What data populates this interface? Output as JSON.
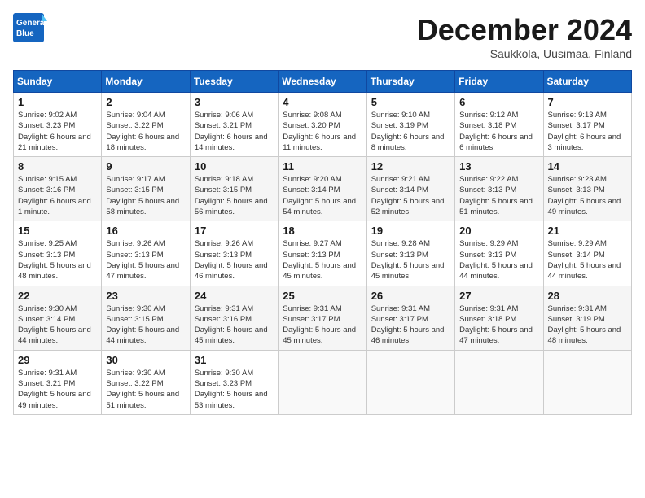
{
  "header": {
    "logo_general": "General",
    "logo_blue": "Blue",
    "month_title": "December 2024",
    "subtitle": "Saukkola, Uusimaa, Finland"
  },
  "days_of_week": [
    "Sunday",
    "Monday",
    "Tuesday",
    "Wednesday",
    "Thursday",
    "Friday",
    "Saturday"
  ],
  "weeks": [
    [
      {
        "day": "1",
        "sunrise": "Sunrise: 9:02 AM",
        "sunset": "Sunset: 3:23 PM",
        "daylight": "Daylight: 6 hours and 21 minutes."
      },
      {
        "day": "2",
        "sunrise": "Sunrise: 9:04 AM",
        "sunset": "Sunset: 3:22 PM",
        "daylight": "Daylight: 6 hours and 18 minutes."
      },
      {
        "day": "3",
        "sunrise": "Sunrise: 9:06 AM",
        "sunset": "Sunset: 3:21 PM",
        "daylight": "Daylight: 6 hours and 14 minutes."
      },
      {
        "day": "4",
        "sunrise": "Sunrise: 9:08 AM",
        "sunset": "Sunset: 3:20 PM",
        "daylight": "Daylight: 6 hours and 11 minutes."
      },
      {
        "day": "5",
        "sunrise": "Sunrise: 9:10 AM",
        "sunset": "Sunset: 3:19 PM",
        "daylight": "Daylight: 6 hours and 8 minutes."
      },
      {
        "day": "6",
        "sunrise": "Sunrise: 9:12 AM",
        "sunset": "Sunset: 3:18 PM",
        "daylight": "Daylight: 6 hours and 6 minutes."
      },
      {
        "day": "7",
        "sunrise": "Sunrise: 9:13 AM",
        "sunset": "Sunset: 3:17 PM",
        "daylight": "Daylight: 6 hours and 3 minutes."
      }
    ],
    [
      {
        "day": "8",
        "sunrise": "Sunrise: 9:15 AM",
        "sunset": "Sunset: 3:16 PM",
        "daylight": "Daylight: 6 hours and 1 minute."
      },
      {
        "day": "9",
        "sunrise": "Sunrise: 9:17 AM",
        "sunset": "Sunset: 3:15 PM",
        "daylight": "Daylight: 5 hours and 58 minutes."
      },
      {
        "day": "10",
        "sunrise": "Sunrise: 9:18 AM",
        "sunset": "Sunset: 3:15 PM",
        "daylight": "Daylight: 5 hours and 56 minutes."
      },
      {
        "day": "11",
        "sunrise": "Sunrise: 9:20 AM",
        "sunset": "Sunset: 3:14 PM",
        "daylight": "Daylight: 5 hours and 54 minutes."
      },
      {
        "day": "12",
        "sunrise": "Sunrise: 9:21 AM",
        "sunset": "Sunset: 3:14 PM",
        "daylight": "Daylight: 5 hours and 52 minutes."
      },
      {
        "day": "13",
        "sunrise": "Sunrise: 9:22 AM",
        "sunset": "Sunset: 3:13 PM",
        "daylight": "Daylight: 5 hours and 51 minutes."
      },
      {
        "day": "14",
        "sunrise": "Sunrise: 9:23 AM",
        "sunset": "Sunset: 3:13 PM",
        "daylight": "Daylight: 5 hours and 49 minutes."
      }
    ],
    [
      {
        "day": "15",
        "sunrise": "Sunrise: 9:25 AM",
        "sunset": "Sunset: 3:13 PM",
        "daylight": "Daylight: 5 hours and 48 minutes."
      },
      {
        "day": "16",
        "sunrise": "Sunrise: 9:26 AM",
        "sunset": "Sunset: 3:13 PM",
        "daylight": "Daylight: 5 hours and 47 minutes."
      },
      {
        "day": "17",
        "sunrise": "Sunrise: 9:26 AM",
        "sunset": "Sunset: 3:13 PM",
        "daylight": "Daylight: 5 hours and 46 minutes."
      },
      {
        "day": "18",
        "sunrise": "Sunrise: 9:27 AM",
        "sunset": "Sunset: 3:13 PM",
        "daylight": "Daylight: 5 hours and 45 minutes."
      },
      {
        "day": "19",
        "sunrise": "Sunrise: 9:28 AM",
        "sunset": "Sunset: 3:13 PM",
        "daylight": "Daylight: 5 hours and 45 minutes."
      },
      {
        "day": "20",
        "sunrise": "Sunrise: 9:29 AM",
        "sunset": "Sunset: 3:13 PM",
        "daylight": "Daylight: 5 hours and 44 minutes."
      },
      {
        "day": "21",
        "sunrise": "Sunrise: 9:29 AM",
        "sunset": "Sunset: 3:14 PM",
        "daylight": "Daylight: 5 hours and 44 minutes."
      }
    ],
    [
      {
        "day": "22",
        "sunrise": "Sunrise: 9:30 AM",
        "sunset": "Sunset: 3:14 PM",
        "daylight": "Daylight: 5 hours and 44 minutes."
      },
      {
        "day": "23",
        "sunrise": "Sunrise: 9:30 AM",
        "sunset": "Sunset: 3:15 PM",
        "daylight": "Daylight: 5 hours and 44 minutes."
      },
      {
        "day": "24",
        "sunrise": "Sunrise: 9:31 AM",
        "sunset": "Sunset: 3:16 PM",
        "daylight": "Daylight: 5 hours and 45 minutes."
      },
      {
        "day": "25",
        "sunrise": "Sunrise: 9:31 AM",
        "sunset": "Sunset: 3:17 PM",
        "daylight": "Daylight: 5 hours and 45 minutes."
      },
      {
        "day": "26",
        "sunrise": "Sunrise: 9:31 AM",
        "sunset": "Sunset: 3:17 PM",
        "daylight": "Daylight: 5 hours and 46 minutes."
      },
      {
        "day": "27",
        "sunrise": "Sunrise: 9:31 AM",
        "sunset": "Sunset: 3:18 PM",
        "daylight": "Daylight: 5 hours and 47 minutes."
      },
      {
        "day": "28",
        "sunrise": "Sunrise: 9:31 AM",
        "sunset": "Sunset: 3:19 PM",
        "daylight": "Daylight: 5 hours and 48 minutes."
      }
    ],
    [
      {
        "day": "29",
        "sunrise": "Sunrise: 9:31 AM",
        "sunset": "Sunset: 3:21 PM",
        "daylight": "Daylight: 5 hours and 49 minutes."
      },
      {
        "day": "30",
        "sunrise": "Sunrise: 9:30 AM",
        "sunset": "Sunset: 3:22 PM",
        "daylight": "Daylight: 5 hours and 51 minutes."
      },
      {
        "day": "31",
        "sunrise": "Sunrise: 9:30 AM",
        "sunset": "Sunset: 3:23 PM",
        "daylight": "Daylight: 5 hours and 53 minutes."
      },
      null,
      null,
      null,
      null
    ]
  ]
}
